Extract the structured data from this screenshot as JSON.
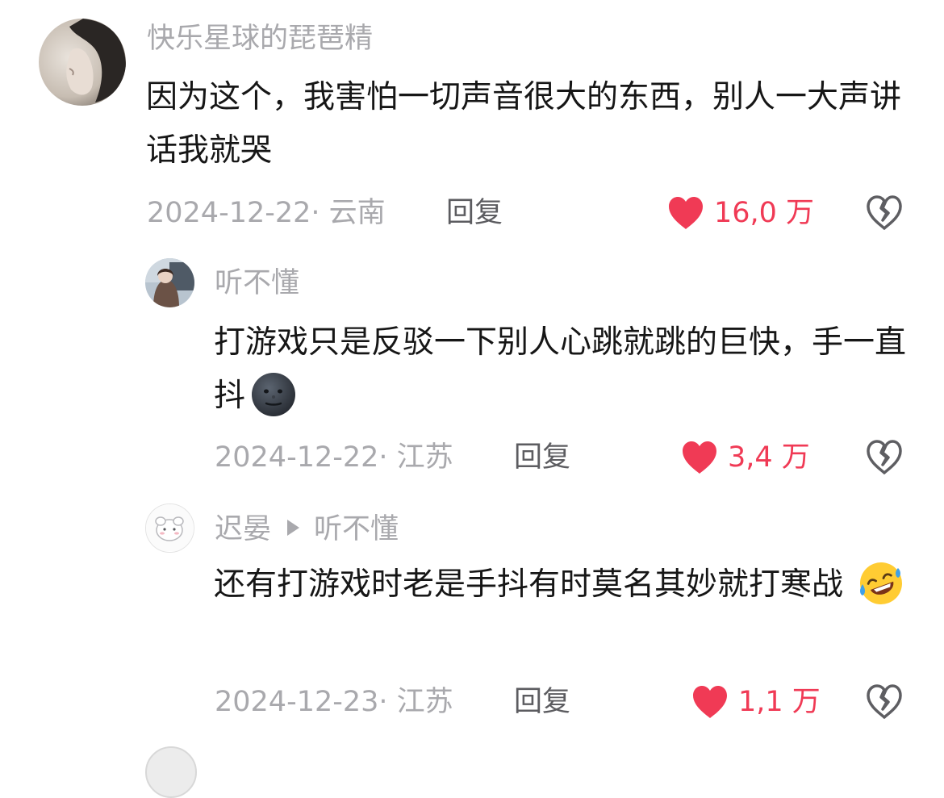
{
  "comments": [
    {
      "username": "快乐星球的琵琶精",
      "text": "因为这个，我害怕一切声音很大的东西，别人一大声讲话我就哭",
      "date_location": "2024-12-22· 云南",
      "reply_label": "回复",
      "likes": "16,0 万",
      "liked": true
    },
    {
      "username": "听不懂",
      "text": "打游戏只是反驳一下别人心跳就跳的巨快，手一直抖",
      "emoji": "new-moon-face-emoji",
      "date_location": "2024-12-22· 江苏",
      "reply_label": "回复",
      "likes": "3,4 万",
      "liked": true
    },
    {
      "username": "迟晏",
      "reply_to": "听不懂",
      "text": "还有打游戏时老是手抖有时莫名其妙就打寒战",
      "emoji": "rofl-emoji",
      "date_location": "2024-12-23· 江苏",
      "reply_label": "回复",
      "likes": "1,1 万",
      "liked": true
    }
  ],
  "colors": {
    "like": "#f03a55",
    "secondary_text": "#a9a9ad",
    "reply_text": "#5c5c60",
    "body_text": "#161616"
  }
}
